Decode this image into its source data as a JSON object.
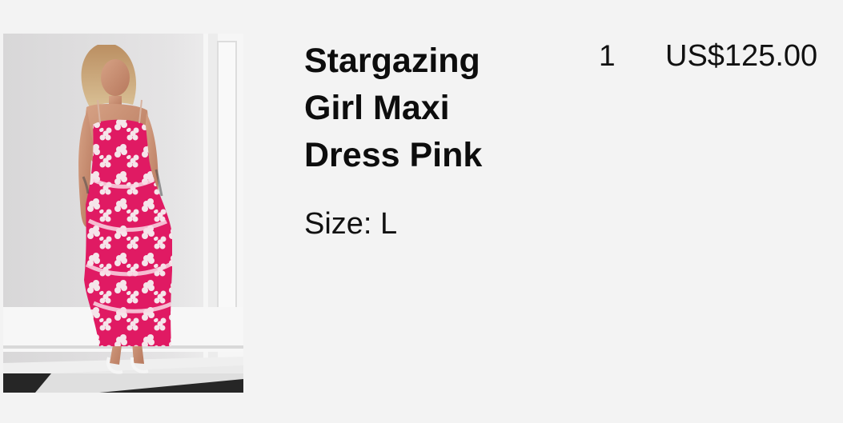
{
  "line_item": {
    "image_alt": "Stargazing Girl Maxi Dress Pink",
    "title_lines": [
      "Stargazing",
      "Girl Maxi",
      "Dress Pink"
    ],
    "size_label": "Size:",
    "size_value": "L",
    "quantity": "1",
    "price": "US$125.00"
  },
  "colors": {
    "background": "#f3f3f3",
    "dress_pink": "#e01a63",
    "flower_white": "#f7f1f2",
    "text": "#111111"
  }
}
